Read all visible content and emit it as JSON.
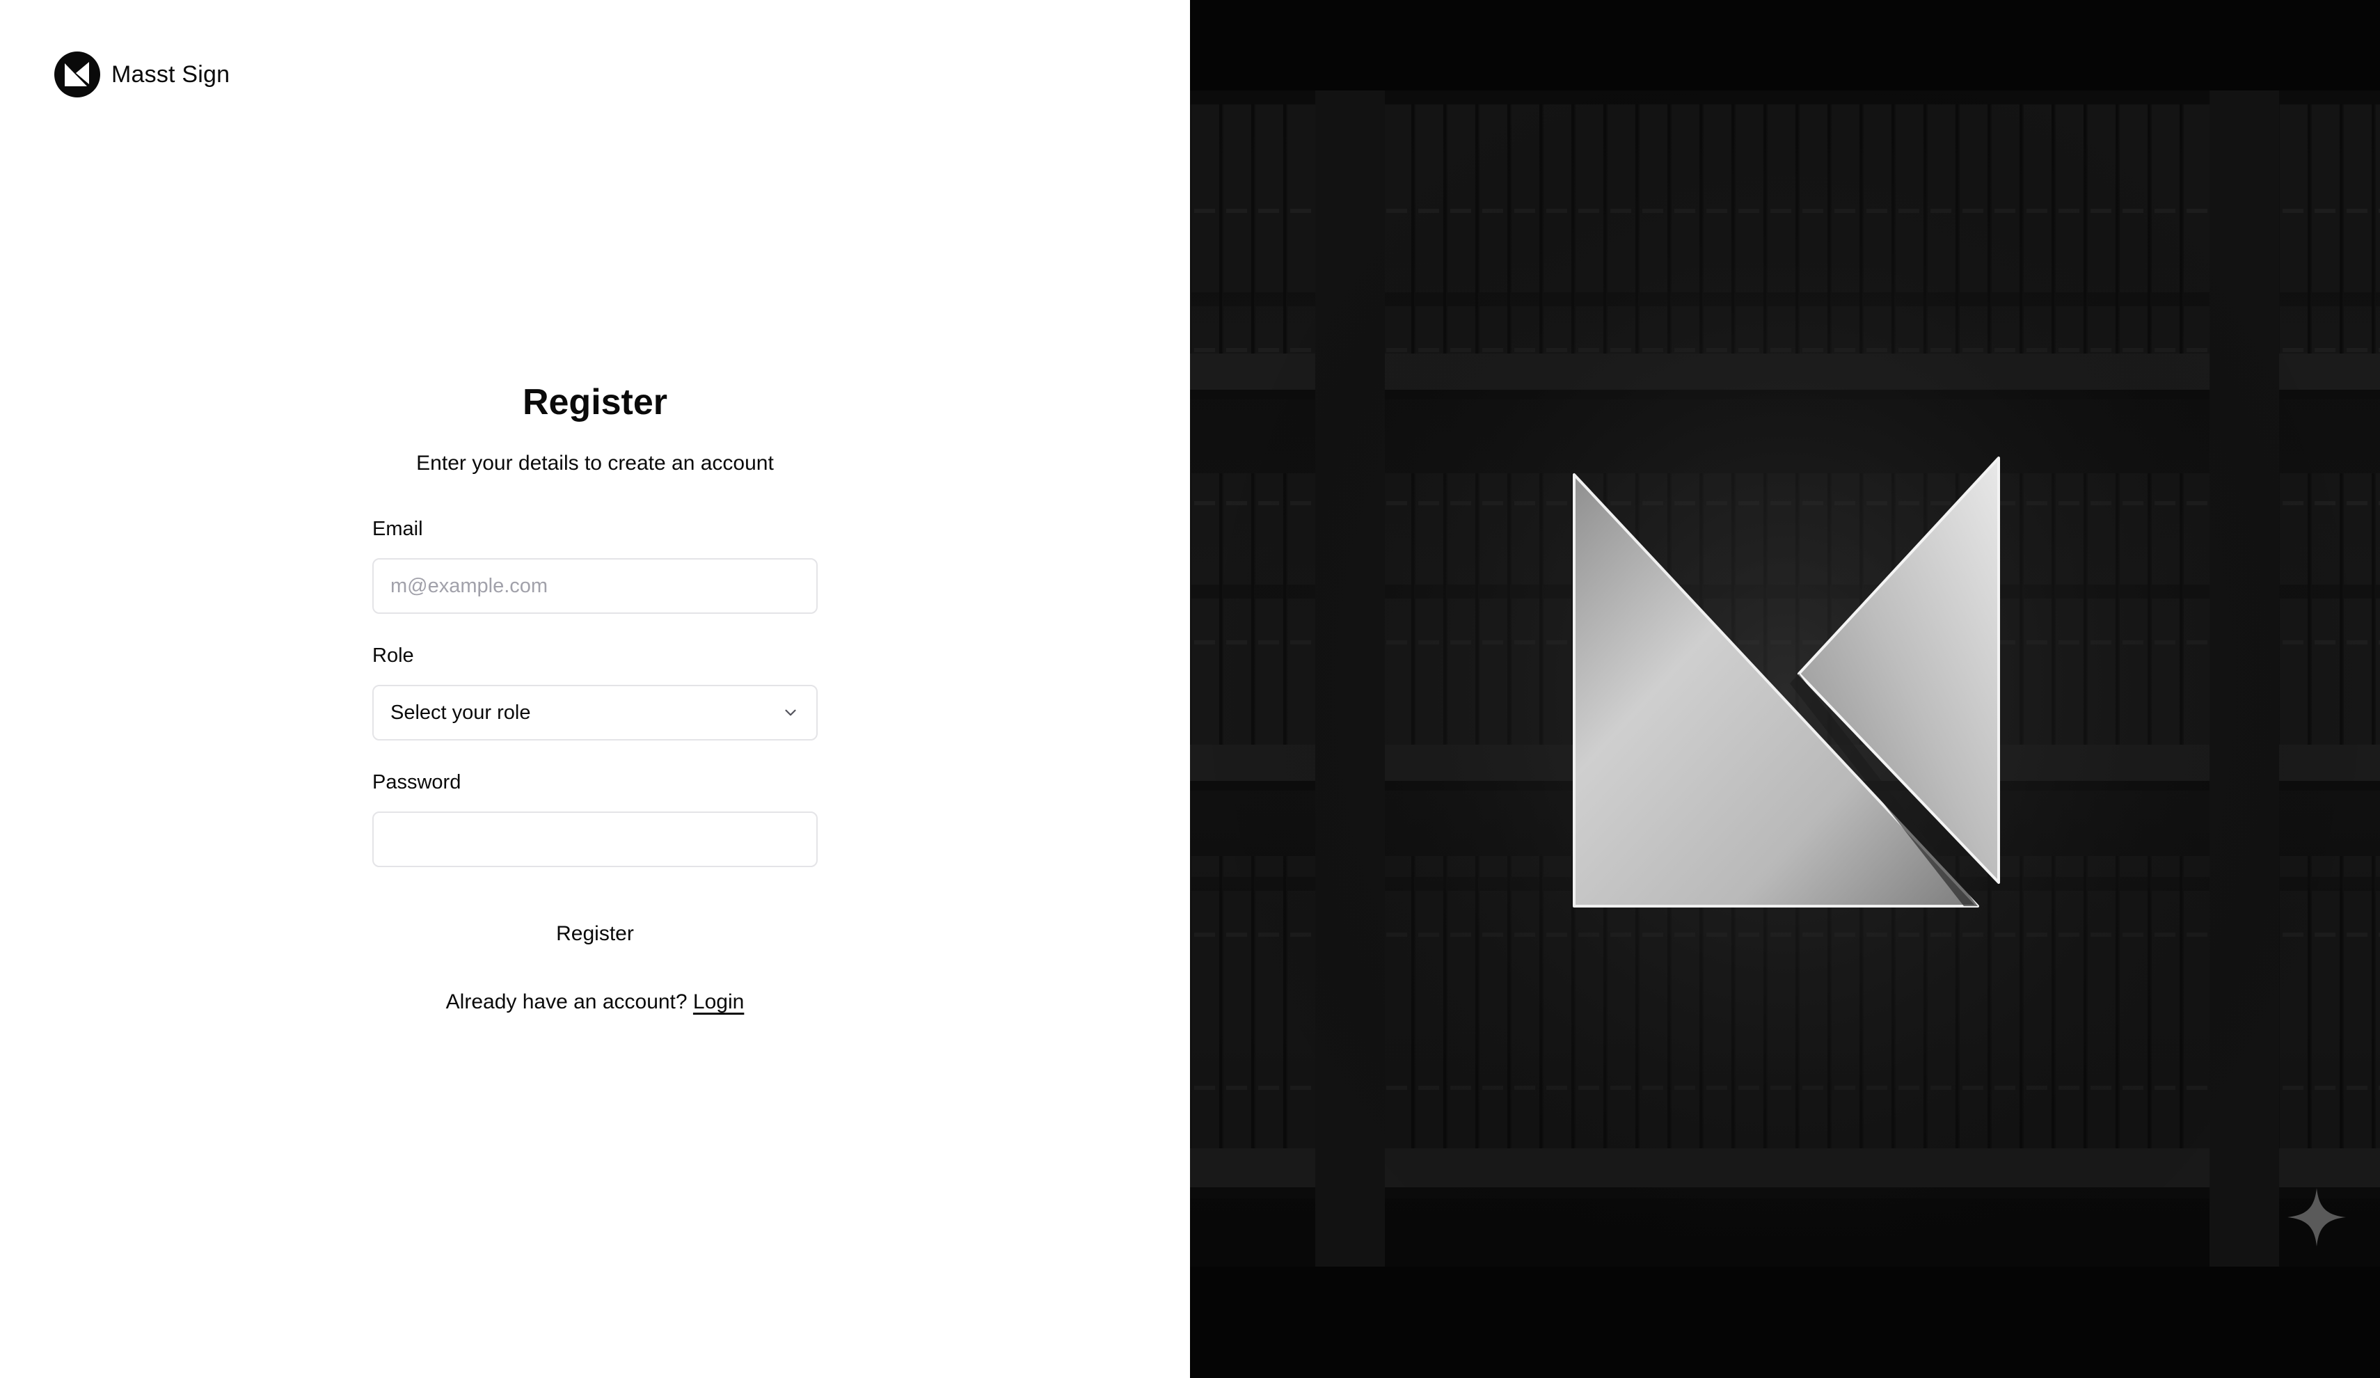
{
  "brand": {
    "name": "Masst Sign",
    "logo_icon": "masst-logo-icon"
  },
  "form": {
    "title": "Register",
    "subtitle": "Enter your details to create an account",
    "email": {
      "label": "Email",
      "placeholder": "m@example.com",
      "value": ""
    },
    "role": {
      "label": "Role",
      "selected": "Select your role",
      "icon": "chevron-down-icon"
    },
    "password": {
      "label": "Password",
      "value": ""
    },
    "submit_label": "Register",
    "login_prompt": "Already have an account?",
    "login_link": "Login"
  },
  "hero": {
    "description_icon": "masst-logo-bookshelf-artwork",
    "corner_icon": "sparkle-icon"
  },
  "colors": {
    "primary_text": "#0a0a0a",
    "input_border": "#e4e4e7",
    "placeholder": "#a1a1aa",
    "hero_background": "#070707"
  }
}
